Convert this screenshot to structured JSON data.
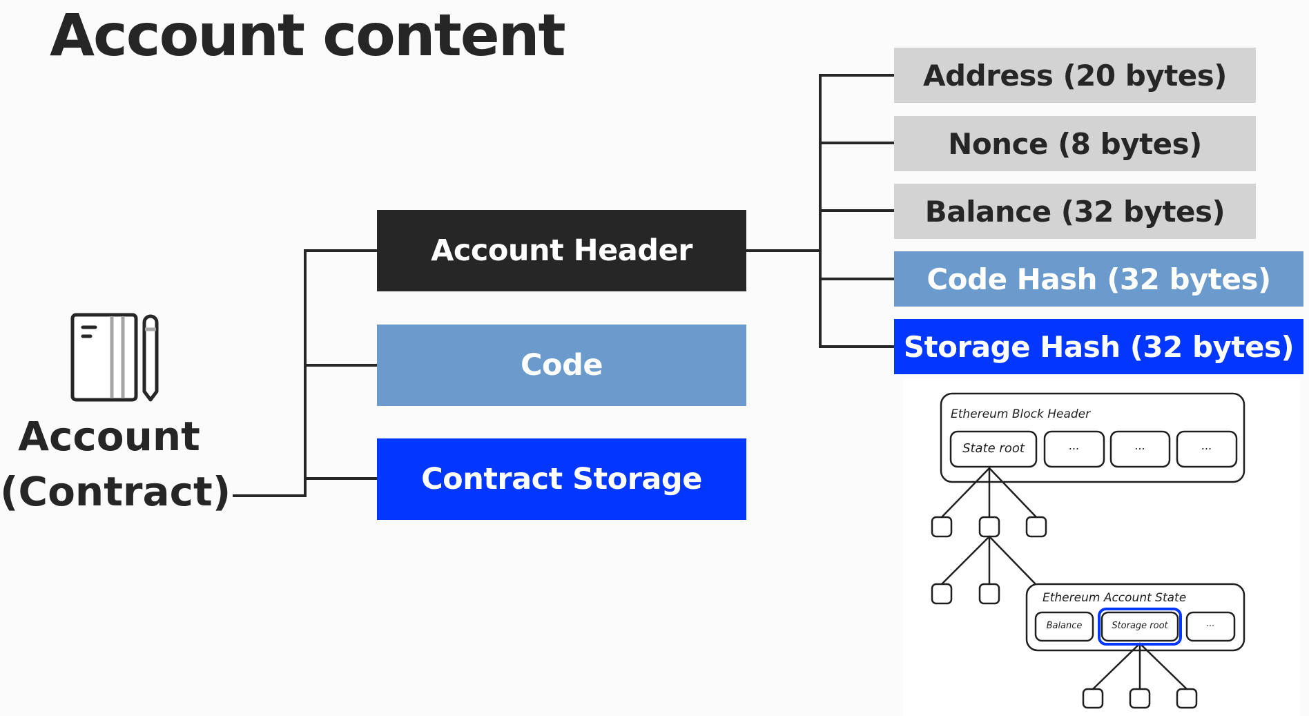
{
  "title": "Account content",
  "account": {
    "icon": "notebook-pencil-icon",
    "label_line1": "Account",
    "label_line2": "(Contract)"
  },
  "components": [
    {
      "label": "Account Header",
      "color": "#262626"
    },
    {
      "label": "Code",
      "color": "#6a9bcc"
    },
    {
      "label": "Contract Storage",
      "color": "#0237ff"
    }
  ],
  "header_fields": [
    {
      "label": "Address (20 bytes)",
      "color": "#d3d3d3"
    },
    {
      "label": "Nonce (8 bytes)",
      "color": "#d3d3d3"
    },
    {
      "label": "Balance (32 bytes)",
      "color": "#d3d3d3"
    },
    {
      "label": "Code Hash (32 bytes)",
      "color": "#6a9bcc"
    },
    {
      "label": "Storage Hash (32 bytes)",
      "color": "#0237ff"
    }
  ],
  "sketch": {
    "block_header": {
      "title": "Ethereum Block Header",
      "cells": [
        "State root",
        "...",
        "...",
        "..."
      ]
    },
    "account_state": {
      "title": "Ethereum Account State",
      "cells": [
        "Balance",
        "Storage root",
        "..."
      ],
      "highlight_color": "#0237ff"
    }
  }
}
